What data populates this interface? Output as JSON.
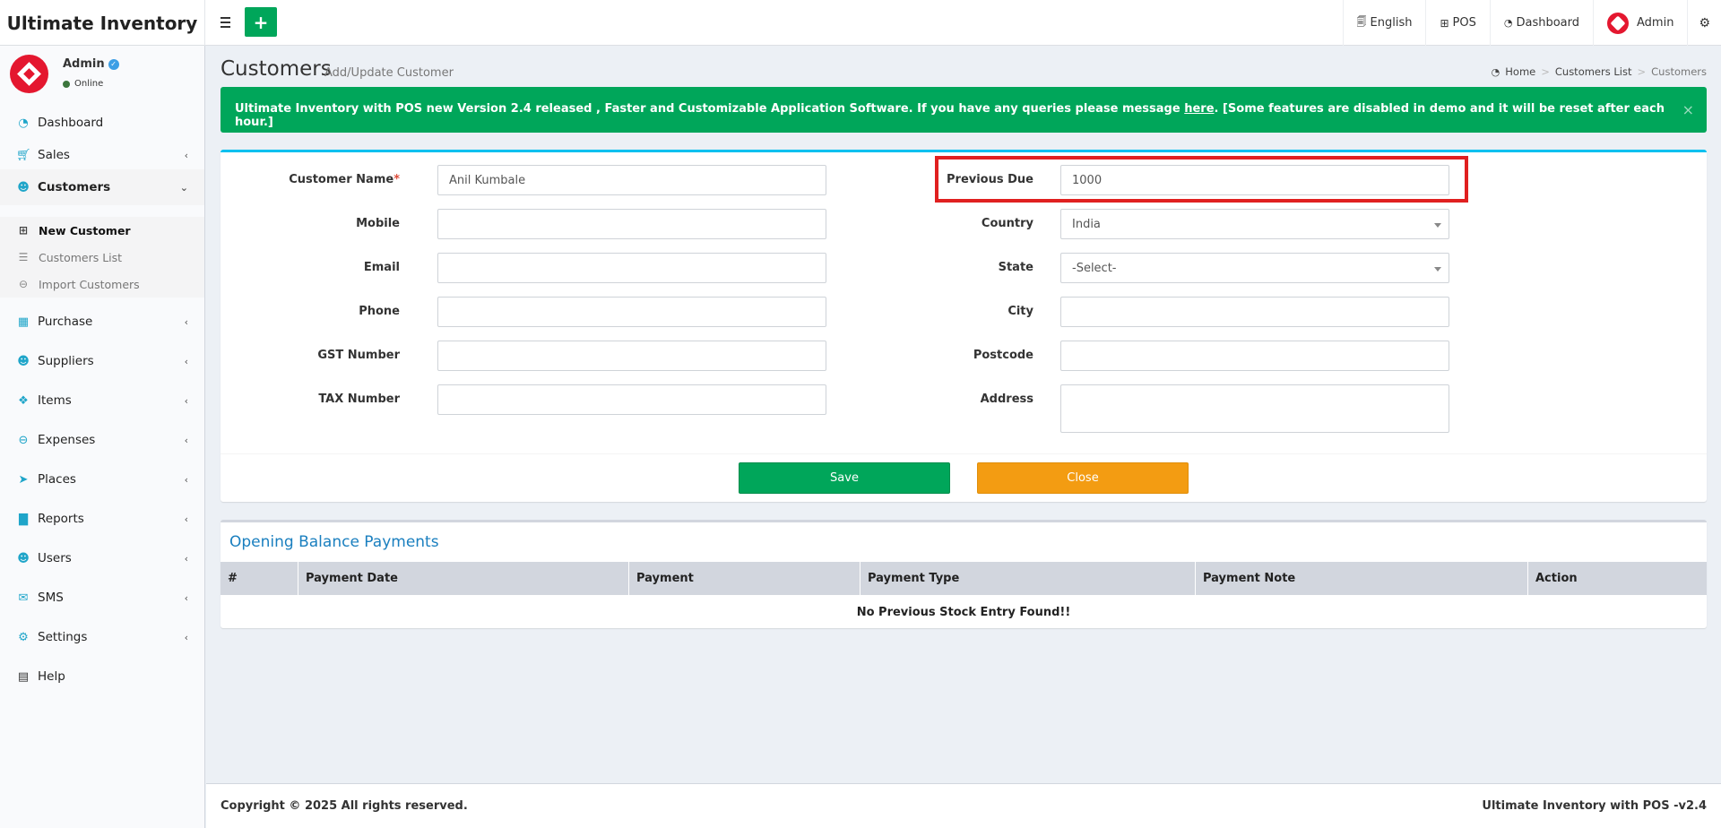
{
  "app": {
    "brand": "Ultimate Inventory"
  },
  "topnav": {
    "language": "English",
    "pos": "POS",
    "dashboard": "Dashboard",
    "user": "Admin"
  },
  "user_panel": {
    "name": "Admin",
    "status": "Online"
  },
  "sidebar": {
    "items": [
      {
        "label": "Dashboard",
        "icon": "dashboard-icon",
        "has_children": false
      },
      {
        "label": "Sales",
        "icon": "cart-icon",
        "has_children": true
      },
      {
        "label": "Customers",
        "icon": "users-icon",
        "has_children": true
      },
      {
        "label": "Purchase",
        "icon": "grid-icon",
        "has_children": true
      },
      {
        "label": "Suppliers",
        "icon": "user-plus-icon",
        "has_children": true
      },
      {
        "label": "Items",
        "icon": "cubes-icon",
        "has_children": true
      },
      {
        "label": "Expenses",
        "icon": "minus-circle-icon",
        "has_children": true
      },
      {
        "label": "Places",
        "icon": "paper-plane-icon",
        "has_children": true
      },
      {
        "label": "Reports",
        "icon": "bar-chart-icon",
        "has_children": true
      },
      {
        "label": "Users",
        "icon": "users-icon",
        "has_children": true
      },
      {
        "label": "SMS",
        "icon": "envelope-icon",
        "has_children": true
      },
      {
        "label": "Settings",
        "icon": "gears-icon",
        "has_children": true
      },
      {
        "label": "Help",
        "icon": "book-icon",
        "has_children": false
      }
    ],
    "customers_submenu": [
      {
        "label": "New Customer",
        "icon": "plus-square-icon"
      },
      {
        "label": "Customers List",
        "icon": "list-icon"
      },
      {
        "label": "Import Customers",
        "icon": "arrow-circle-icon"
      }
    ]
  },
  "header": {
    "title": "Customers",
    "subtitle": "Add/Update Customer",
    "breadcrumb": [
      "Home",
      "Customers List",
      "Customers"
    ]
  },
  "alert": {
    "text_before": "Ultimate Inventory with POS new Version 2.4 released , Faster and Customizable Application Software. If you have any queries please message ",
    "link": "here",
    "text_after": ". [Some features are disabled in demo and it will be reset after each hour.]",
    "close": "×"
  },
  "form": {
    "left": [
      {
        "label": "Customer Name",
        "required": "*",
        "value": ""
      },
      {
        "label": "Mobile",
        "value": ""
      },
      {
        "label": "Email",
        "value": ""
      },
      {
        "label": "Phone",
        "value": ""
      },
      {
        "label": "GST Number",
        "value": ""
      },
      {
        "label": "TAX Number",
        "value": ""
      }
    ],
    "customer_name_value": "Anil Kumbale",
    "right": [
      {
        "label": "Previous Due",
        "value": "1000"
      },
      {
        "label": "Country",
        "value": "India"
      },
      {
        "label": "State",
        "value": "-Select-"
      },
      {
        "label": "City",
        "value": ""
      },
      {
        "label": "Postcode",
        "value": ""
      },
      {
        "label": "Address",
        "value": ""
      }
    ],
    "save": "Save",
    "close": "Close"
  },
  "payments": {
    "title": "Opening Balance Payments",
    "columns": [
      "#",
      "Payment Date",
      "Payment",
      "Payment Type",
      "Payment Note",
      "Action"
    ],
    "empty": "No Previous Stock Entry Found!!"
  },
  "footer": {
    "copyright": "Copyright © 2025 All rights reserved.",
    "version": "Ultimate Inventory with POS -v2.4"
  },
  "colors": {
    "accent_green": "#00a65a",
    "accent_orange": "#f39c12",
    "accent_cyan": "#00c0ef",
    "highlight_red": "#e02020"
  }
}
